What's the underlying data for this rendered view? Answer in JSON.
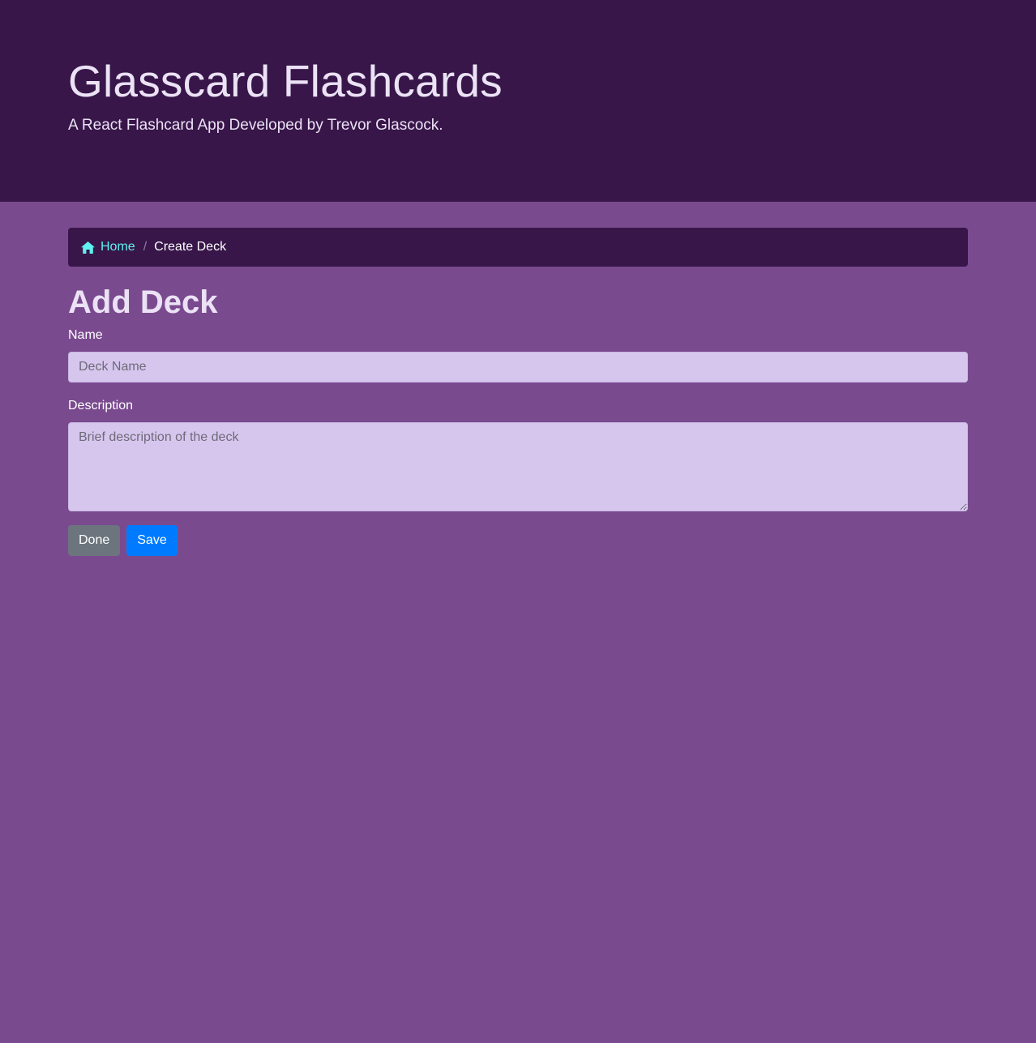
{
  "header": {
    "title": "Glasscard Flashcards",
    "subtitle": "A React Flashcard App Developed by Trevor Glascock."
  },
  "breadcrumb": {
    "home_icon": "home-icon",
    "home_label": "Home",
    "separator": "/",
    "current_label": "Create Deck"
  },
  "form": {
    "heading": "Add Deck",
    "name_label": "Name",
    "name_value": "",
    "name_placeholder": "Deck Name",
    "description_label": "Description",
    "description_value": "",
    "description_placeholder": "Brief description of the deck",
    "done_label": "Done",
    "save_label": "Save"
  },
  "colors": {
    "header_bg": "#381649",
    "page_bg": "#7a4a8f",
    "link": "#5ff2f0",
    "input_bg": "#d6c6ee",
    "done_button": "#6c757d",
    "save_button": "#007bff"
  }
}
